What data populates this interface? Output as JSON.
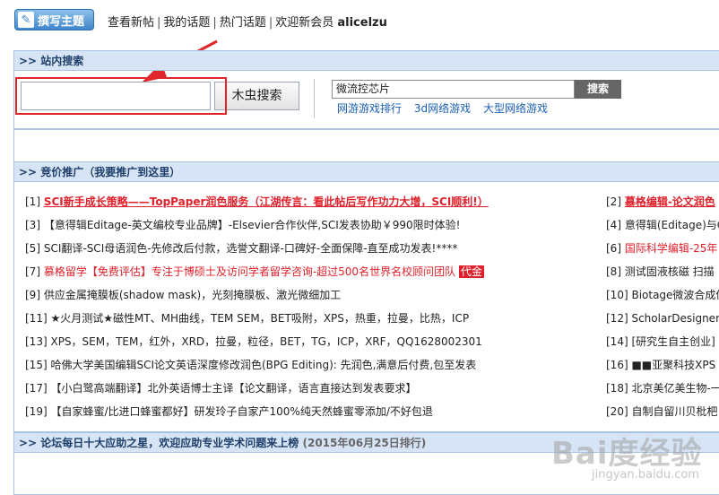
{
  "topbar": {
    "post_button": "撰写主题",
    "links": [
      "查看新帖",
      "我的话题",
      "热门话题"
    ],
    "welcome": "欢迎新会员",
    "username": "alicelzu"
  },
  "search": {
    "header": ">> 站内搜索",
    "input_value": "",
    "button": "木虫搜索",
    "ad_input_value": "微流控芯片",
    "ad_button": "搜索",
    "ad_links": [
      "网游游戏排行",
      "3d网络游戏",
      "大型网络游戏"
    ]
  },
  "promo": {
    "header": ">> 竞价推广（我要推广到这里）",
    "left": [
      {
        "n": "[1]",
        "text": "SCI新手成长策略——TopPaper润色服务（江湖传言：看此帖后写作功力大增，SCI顺利!）"
      },
      {
        "n": "[3]",
        "text": "【意得辑Editage-英文编校专业品牌】-Elsevier合作伙伴,SCI发表协助￥990限时体验!"
      },
      {
        "n": "[5]",
        "text": "SCI翻译-SCI母语润色-先修改后付款，选誉文翻译-口碑好-全面保障-直至成功发表!****"
      },
      {
        "n": "[7]",
        "text": "慕格留学【免费评估】专注于博硕士及访问学者留学咨询-超过500名世界名校顾问团队",
        "tag": "代金"
      },
      {
        "n": "[9]",
        "text": "供应金属掩膜板(shadow mask)，光刻掩膜板、激光微细加工"
      },
      {
        "n": "[11]",
        "text": "★火月测试★磁性MT、MH曲线，TEM SEM，BET吸附，XPS，热重，拉曼，比热，ICP"
      },
      {
        "n": "[13]",
        "text": "XPS，SEM，TEM，红外，XRD，拉曼，粒径，BET，TG，ICP，XRF，QQ1628002301"
      },
      {
        "n": "[15]",
        "text": "哈佛大学美国编辑SCI论文英语深度修改润色(BPG Editing): 先润色,满意后付费,包至发表"
      },
      {
        "n": "[17]",
        "text": "【小白鹭高端翻译】北外英语博士主译【论文翻译，语言直接达到发表要求】"
      },
      {
        "n": "[19]",
        "text": "【自家蜂蜜/比进口蜂蜜都好】研发玲子自家产100%纯天然蜂蜜零添加/不好包退"
      }
    ],
    "right": [
      {
        "n": "[2]",
        "text": "慕格编辑-论文润色"
      },
      {
        "n": "[4]",
        "text": "意得辑(Editage)与Clar"
      },
      {
        "n": "[6]",
        "text": "国际科学编辑-25年"
      },
      {
        "n": "[8]",
        "text": "测试固液核磁 扫描"
      },
      {
        "n": "[10]",
        "text": "Biotage微波合成仪"
      },
      {
        "n": "[12]",
        "text": "ScholarDesigner 学"
      },
      {
        "n": "[14]",
        "text": "[研究生自主创业]"
      },
      {
        "n": "[16]",
        "text": "■■亚聚科技XPS"
      },
      {
        "n": "[18]",
        "text": "北京美亿美生物-一"
      },
      {
        "n": "[20]",
        "text": "自制自留川贝枇杷"
      }
    ]
  },
  "stars": {
    "header": ">> 论坛每日十大应助之星，欢迎应助专业学术问题来上榜",
    "date_note": "(2015年06月25日排行)"
  },
  "watermark": {
    "logo": "Bai度经验",
    "sub": "jingyan.baidu.com"
  },
  "colors": {
    "accent_red": "#e0202a",
    "panel_head_bg": "#d6e4f5",
    "link_blue": "#1a5fb4"
  }
}
